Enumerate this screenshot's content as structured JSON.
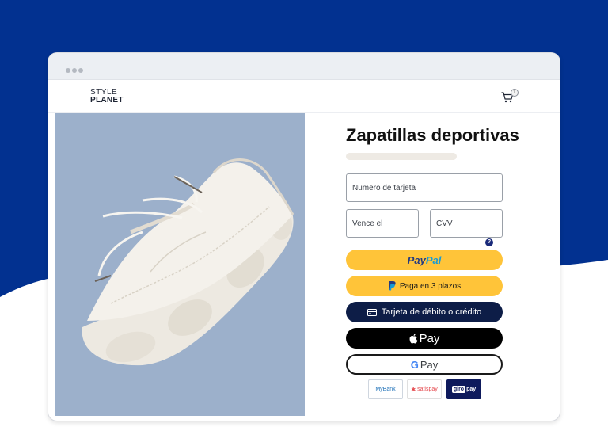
{
  "colors": {
    "backdrop_navy": "#023190",
    "product_bg": "#9cb0cb",
    "paypal_yellow": "#ffc439",
    "card_navy": "#0d1d47"
  },
  "header": {
    "logo_top": "STYLE",
    "logo_bottom": "PLANET",
    "cart_icon": "cart-icon",
    "cart_count": "1"
  },
  "product": {
    "image": "white-sneaker-photo",
    "title": "Zapatillas deportivas"
  },
  "form": {
    "card_number_placeholder": "Numero de tarjeta",
    "expiry_placeholder": "Vence el",
    "cvv_placeholder": "CVV",
    "cvv_help_icon": "question-icon",
    "cvv_help_glyph": "?"
  },
  "payment_buttons": {
    "paypal_part1": "Pay",
    "paypal_part2": "Pal",
    "pay_later_label": "Paga en 3 plazos",
    "card_label": "Tarjeta de débito o crédito",
    "apple_pay_label": "Pay",
    "google_g": "G",
    "google_pay_label": "Pay"
  },
  "alt_methods": {
    "mybank": "MyBank",
    "satispay": "satispay",
    "giropay_part1": "giro",
    "giropay_part2": "pay"
  }
}
